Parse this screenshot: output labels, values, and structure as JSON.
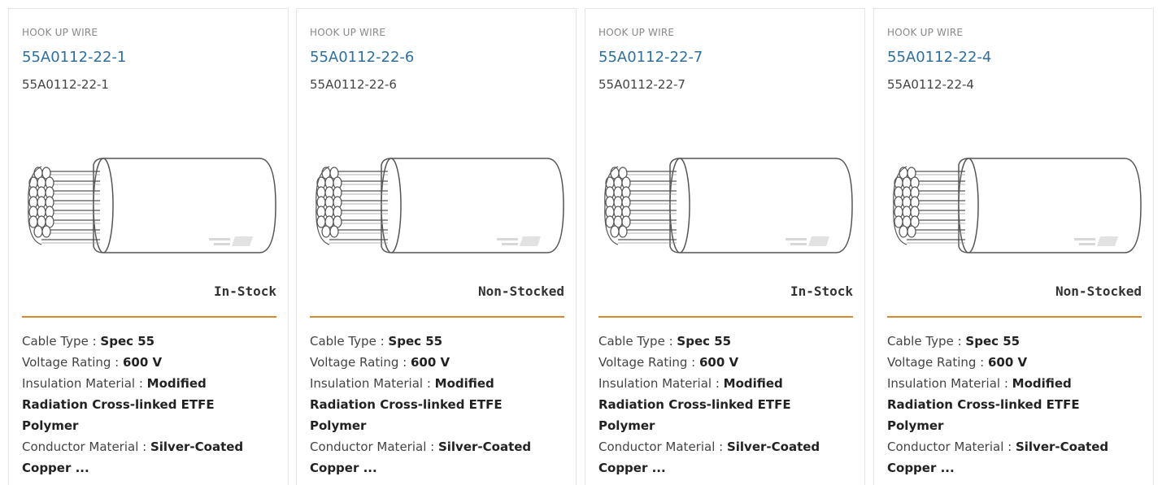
{
  "cards": [
    {
      "category": "HOOK UP WIRE",
      "part_link": "55A0112-22-1",
      "part_sub": "55A0112-22-1",
      "image_icon": "wire-cable-icon",
      "stock_status": "In-Stock",
      "specs": [
        {
          "label": "Cable Type",
          "sep": " : ",
          "value": "Spec 55"
        },
        {
          "label": "Voltage Rating",
          "sep": " : ",
          "value": "600 V"
        },
        {
          "label": "Insulation Material",
          "sep": " : ",
          "value": "Modified Radiation Cross-linked ETFE Polymer"
        },
        {
          "label": "Conductor Material",
          "sep": " : ",
          "value": "Silver-Coated Copper ..."
        }
      ]
    },
    {
      "category": "HOOK UP WIRE",
      "part_link": "55A0112-22-6",
      "part_sub": "55A0112-22-6",
      "image_icon": "wire-cable-icon",
      "stock_status": "Non-Stocked",
      "specs": [
        {
          "label": "Cable Type",
          "sep": " : ",
          "value": "Spec 55"
        },
        {
          "label": "Voltage Rating",
          "sep": " : ",
          "value": "600 V"
        },
        {
          "label": "Insulation Material",
          "sep": " : ",
          "value": "Modified Radiation Cross-linked ETFE Polymer"
        },
        {
          "label": "Conductor Material",
          "sep": " : ",
          "value": "Silver-Coated Copper ..."
        }
      ]
    },
    {
      "category": "HOOK UP WIRE",
      "part_link": "55A0112-22-7",
      "part_sub": "55A0112-22-7",
      "image_icon": "wire-cable-icon",
      "stock_status": "In-Stock",
      "specs": [
        {
          "label": "Cable Type",
          "sep": " : ",
          "value": "Spec 55"
        },
        {
          "label": "Voltage Rating",
          "sep": " : ",
          "value": "600 V"
        },
        {
          "label": "Insulation Material",
          "sep": " : ",
          "value": "Modified Radiation Cross-linked ETFE Polymer"
        },
        {
          "label": "Conductor Material",
          "sep": " : ",
          "value": "Silver-Coated Copper ..."
        }
      ]
    },
    {
      "category": "HOOK UP WIRE",
      "part_link": "55A0112-22-4",
      "part_sub": "55A0112-22-4",
      "image_icon": "wire-cable-icon",
      "stock_status": "Non-Stocked",
      "specs": [
        {
          "label": "Cable Type",
          "sep": " : ",
          "value": "Spec 55"
        },
        {
          "label": "Voltage Rating",
          "sep": " : ",
          "value": "600 V"
        },
        {
          "label": "Insulation Material",
          "sep": " : ",
          "value": "Modified Radiation Cross-linked ETFE Polymer"
        },
        {
          "label": "Conductor Material",
          "sep": " : ",
          "value": "Silver-Coated Copper ..."
        }
      ]
    }
  ],
  "colors": {
    "link": "#2e6f9e",
    "divider": "#d9892b",
    "category": "#888888",
    "card_border": "#e4e4e4"
  }
}
